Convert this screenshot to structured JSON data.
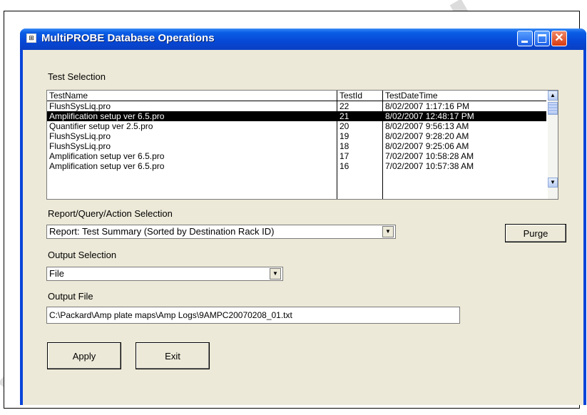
{
  "window": {
    "title": "MultiPROBE Database Operations",
    "title_icon": "⊞",
    "close_glyph": "✕"
  },
  "test_selection": {
    "label": "Test Selection",
    "columns": [
      "TestName",
      "TestId",
      "TestDateTime"
    ],
    "rows": [
      {
        "name": "FlushSysLiq.pro",
        "id": "22",
        "datetime": "8/02/2007 1:17:16 PM",
        "selected": false
      },
      {
        "name": "Amplification setup ver 6.5.pro",
        "id": "21",
        "datetime": "8/02/2007 12:48:17 PM",
        "selected": true
      },
      {
        "name": "Quantifier setup ver 2.5.pro",
        "id": "20",
        "datetime": "8/02/2007 9:56:13 AM",
        "selected": false
      },
      {
        "name": "FlushSysLiq.pro",
        "id": "19",
        "datetime": "8/02/2007 9:28:20 AM",
        "selected": false
      },
      {
        "name": "FlushSysLiq.pro",
        "id": "18",
        "datetime": "8/02/2007 9:25:06 AM",
        "selected": false
      },
      {
        "name": "Amplification setup ver 6.5.pro",
        "id": "17",
        "datetime": "7/02/2007 10:58:28 AM",
        "selected": false
      },
      {
        "name": "Amplification setup ver 6.5.pro",
        "id": "16",
        "datetime": "7/02/2007 10:57:38 AM",
        "selected": false
      }
    ],
    "scroll_up_glyph": "▲",
    "scroll_down_glyph": "▼"
  },
  "report_selection": {
    "label": "Report/Query/Action Selection",
    "value": "Report: Test Summary (Sorted by Destination Rack ID)",
    "dropdown_glyph": "▼"
  },
  "purge_button": "Purge",
  "output_selection": {
    "label": "Output Selection",
    "value": "File",
    "dropdown_glyph": "▼"
  },
  "output_file": {
    "label": "Output File",
    "value": "C:\\Packard\\Amp plate maps\\Amp Logs\\9AMPC20070208_01.txt"
  },
  "buttons": {
    "apply": "Apply",
    "exit": "Exit"
  },
  "colors": {
    "title_bar": "#0648d6",
    "dialog_bg": "#ece9d8",
    "selection_bg": "#000000",
    "close_button": "#d83a10"
  }
}
